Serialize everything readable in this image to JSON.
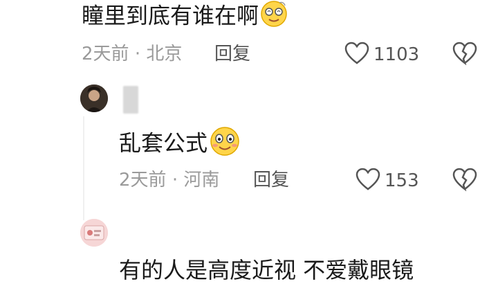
{
  "comments": [
    {
      "text": "瞳里到底有谁在啊",
      "emoji": "dizzy-face-emoji",
      "meta_time": "2天前",
      "meta_sep": "·",
      "meta_location": "北京",
      "reply_label": "回复",
      "like_count": "1103"
    },
    {
      "text": "乱套公式",
      "emoji": "smiling-face-emoji",
      "meta_time": "2天前",
      "meta_sep": "·",
      "meta_location": "河南",
      "reply_label": "回复",
      "like_count": "153"
    },
    {
      "text": "有的人是高度近视 不爱戴眼镜"
    }
  ],
  "colors": {
    "text": "#1a1a1a",
    "meta": "#9a9a9a",
    "icon": "#555555",
    "emoji_fill": "#ffd54a"
  }
}
